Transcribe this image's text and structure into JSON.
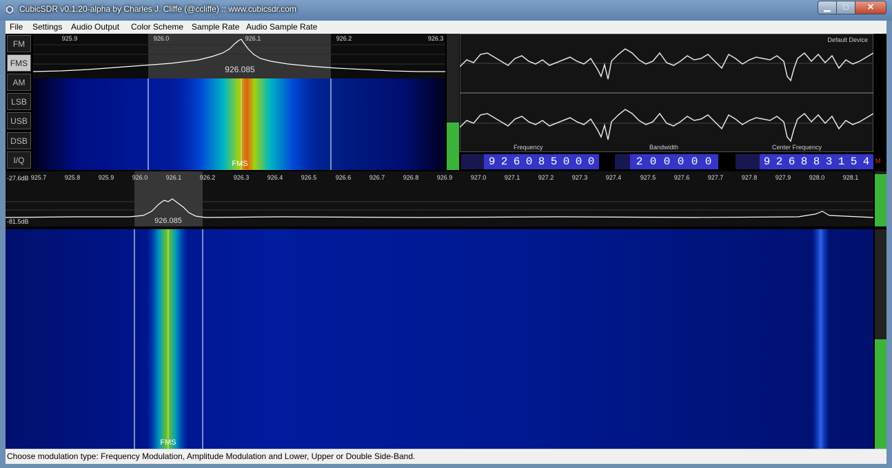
{
  "window": {
    "title": "CubicSDR v0.1.20-alpha by Charles J. Cliffe (@ccliffe)  ::  www.cubicsdr.com",
    "minimize_glyph": "▁",
    "maximize_glyph": "□",
    "close_glyph": "✕"
  },
  "menu": [
    "File",
    "Settings",
    "Audio Output",
    "Color Scheme",
    "Sample Rate",
    "Audio Sample Rate"
  ],
  "modes": [
    {
      "label": "FM",
      "active": false
    },
    {
      "label": "FMS",
      "active": true
    },
    {
      "label": "AM",
      "active": false
    },
    {
      "label": "LSB",
      "active": false
    },
    {
      "label": "USB",
      "active": false
    },
    {
      "label": "DSB",
      "active": false
    },
    {
      "label": "I/Q",
      "active": false
    }
  ],
  "demod_spectrum": {
    "ticks": [
      "925.9",
      "926.0",
      "926.1",
      "926.2",
      "926.3"
    ],
    "center_label": "926.085",
    "waterfall_marker": "FMS"
  },
  "scope": {
    "device_label": "Default Device"
  },
  "tuner": {
    "frequency_label": "Frequency",
    "frequency_digits": [
      "9",
      "2",
      "6",
      "0",
      "8",
      "5",
      "0",
      "0",
      "0"
    ],
    "bandwidth_label": "Bandwidth",
    "bandwidth_digits": [
      "2",
      "0",
      "0",
      "0",
      "0",
      "0"
    ],
    "center_label": "Center  Frequency",
    "center_digits": [
      "9",
      "2",
      "6",
      "8",
      "8",
      "3",
      "1",
      "5",
      "4"
    ],
    "m_label": "M"
  },
  "main_spectrum": {
    "db_top": "-27.6dB",
    "db_bottom": "-81.5dB",
    "ticks": [
      "925.7",
      "925.8",
      "925.9",
      "926.0",
      "926.1",
      "926.2",
      "926.3",
      "926.4",
      "926.5",
      "926.6",
      "926.7",
      "926.8",
      "926.9",
      "927.0",
      "927.1",
      "927.2",
      "927.3",
      "927.4",
      "927.5",
      "927.6",
      "927.7",
      "927.8",
      "927.9",
      "928.0",
      "928.1"
    ],
    "center_label": "926.085",
    "waterfall_marker": "FMS"
  },
  "meters": {
    "squelch_level": 0.35,
    "spectrum_level": 0.95,
    "waterfall_level": 0.5
  },
  "status": "Choose modulation type: Frequency Modulation, Amplitude Modulation and Lower, Upper or Double Side-Band.",
  "colors": {
    "accent_blue": "#3535c8",
    "meter_green": "#3cb43c"
  }
}
